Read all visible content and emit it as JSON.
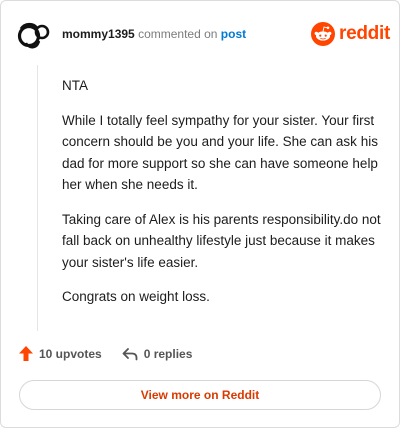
{
  "header": {
    "username": "mommy1395",
    "action_text": "commented on",
    "post_link": "post"
  },
  "brand": {
    "logo_text": "reddit",
    "icon": "reddit-snoo-icon",
    "color": "#ff4500"
  },
  "avatar": {
    "icon": "mother-child-avatar-icon"
  },
  "comment": {
    "paragraphs": [
      "NTA",
      "While I totally feel sympathy for your sister. Your first concern should be you and your life. She can ask his dad for more support so she can have someone help her when she needs it.",
      "Taking care of Alex is his parents responsibility.do not fall back on unhealthy lifestyle just because it makes your sister's life easier.",
      "Congrats on weight loss."
    ]
  },
  "actions": {
    "upvotes_label": "10 upvotes",
    "replies_label": "0 replies",
    "upvote_icon": "upvote-arrow-icon",
    "reply_icon": "reply-arrow-icon",
    "upvote_color": "#ff4500"
  },
  "footer": {
    "view_more_label": "View more on Reddit",
    "view_more_color": "#d93a00"
  }
}
